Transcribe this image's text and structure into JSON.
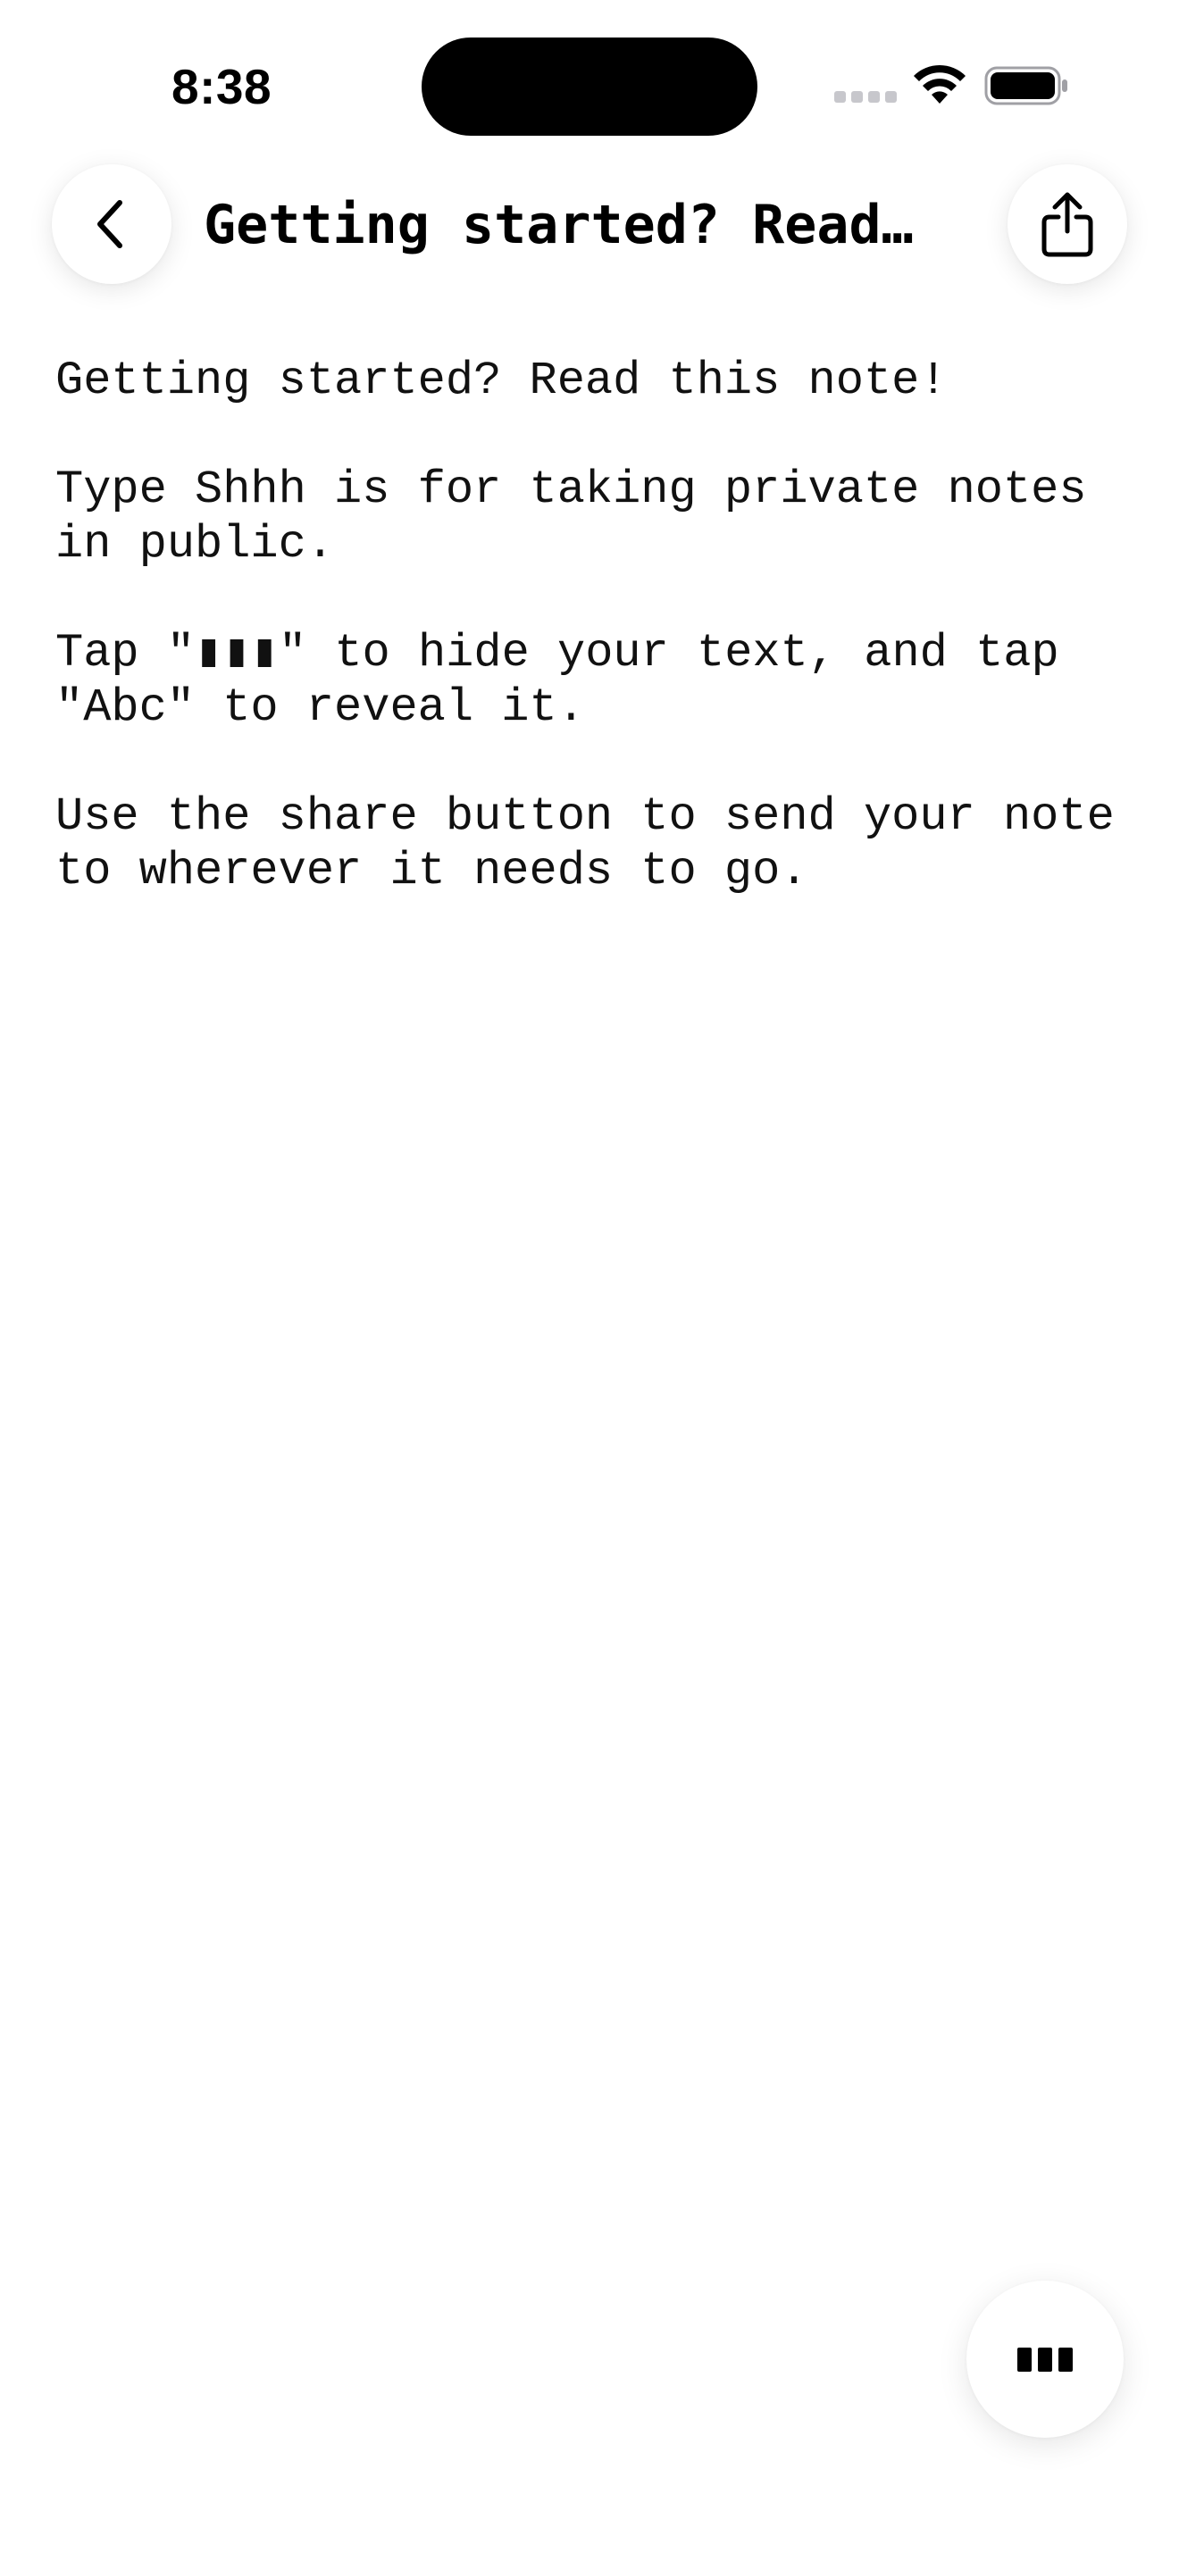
{
  "status_bar": {
    "time": "8:38"
  },
  "header": {
    "title": "Getting started? Read this note!",
    "back_icon": "chevron-left-icon",
    "share_icon": "share-icon"
  },
  "note": {
    "paragraphs": [
      "Getting started? Read this note!",
      "Type Shhh is for taking private notes in public.",
      "Tap \"▮▮▮\" to hide your text, and tap \"Abc\" to reveal it.",
      "Use the share button to send your note to wherever it needs to go."
    ]
  },
  "floating": {
    "hide_icon": "hide-text-bars-icon"
  },
  "colors": {
    "background": "#ffffff",
    "text": "#111111",
    "button_bg": "#ffffff"
  }
}
